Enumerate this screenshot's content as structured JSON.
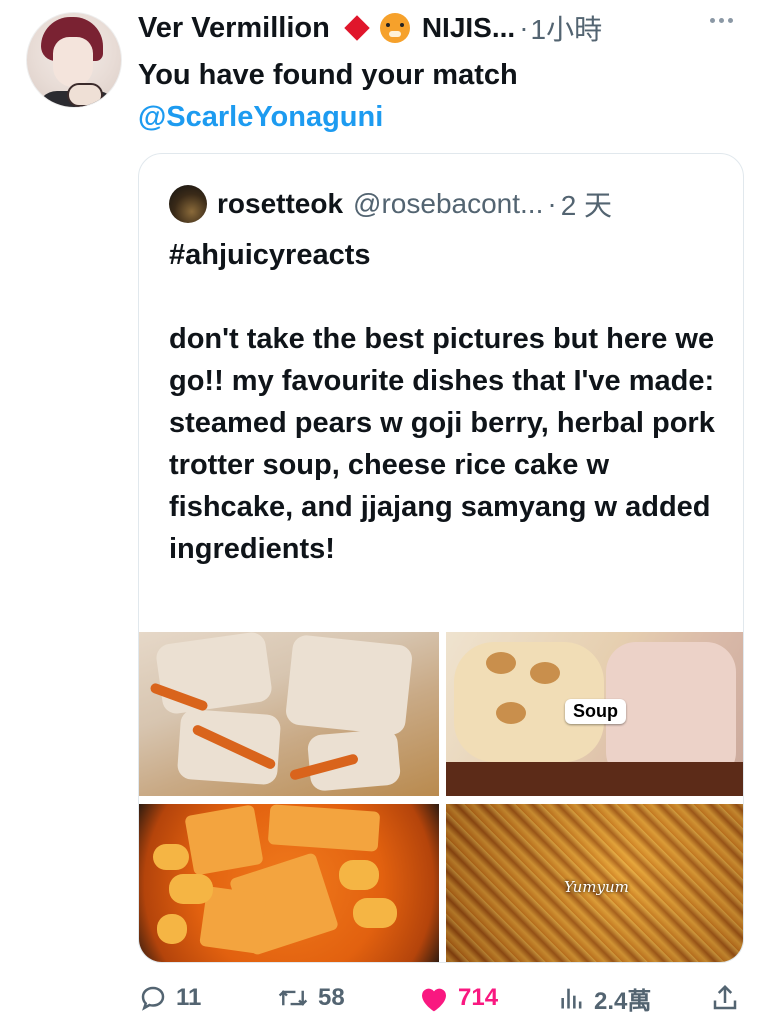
{
  "tweet": {
    "author_name": "Ver Vermillion",
    "org": "NIJIS...",
    "separator": "·",
    "time": "1小時",
    "text": "You have found your match",
    "mention": "@ScarleYonaguni"
  },
  "quote": {
    "name": "rosetteok",
    "handle": "@rosebacont...",
    "separator": "·",
    "time": "2 天",
    "hashtag": "#ahjuicyreacts",
    "body": "don't take the best pictures but here we go!! my favourite dishes that I've made: steamed pears w goji berry, herbal pork trotter soup, cheese rice cake w fishcake, and jjajang samyang w added ingredients!",
    "photo_labels": {
      "soup": "Soup",
      "yum": "Yumyum"
    }
  },
  "actions": {
    "replies": "11",
    "retweets": "58",
    "likes": "714",
    "views": "2.4萬"
  },
  "colors": {
    "accent": "#1d9bf0",
    "like": "#f91880",
    "muted": "#536471"
  },
  "icons": [
    "diamond-icon",
    "tiger-icon",
    "more-icon",
    "reply-icon",
    "retweet-icon",
    "heart-icon",
    "views-icon",
    "share-icon"
  ]
}
